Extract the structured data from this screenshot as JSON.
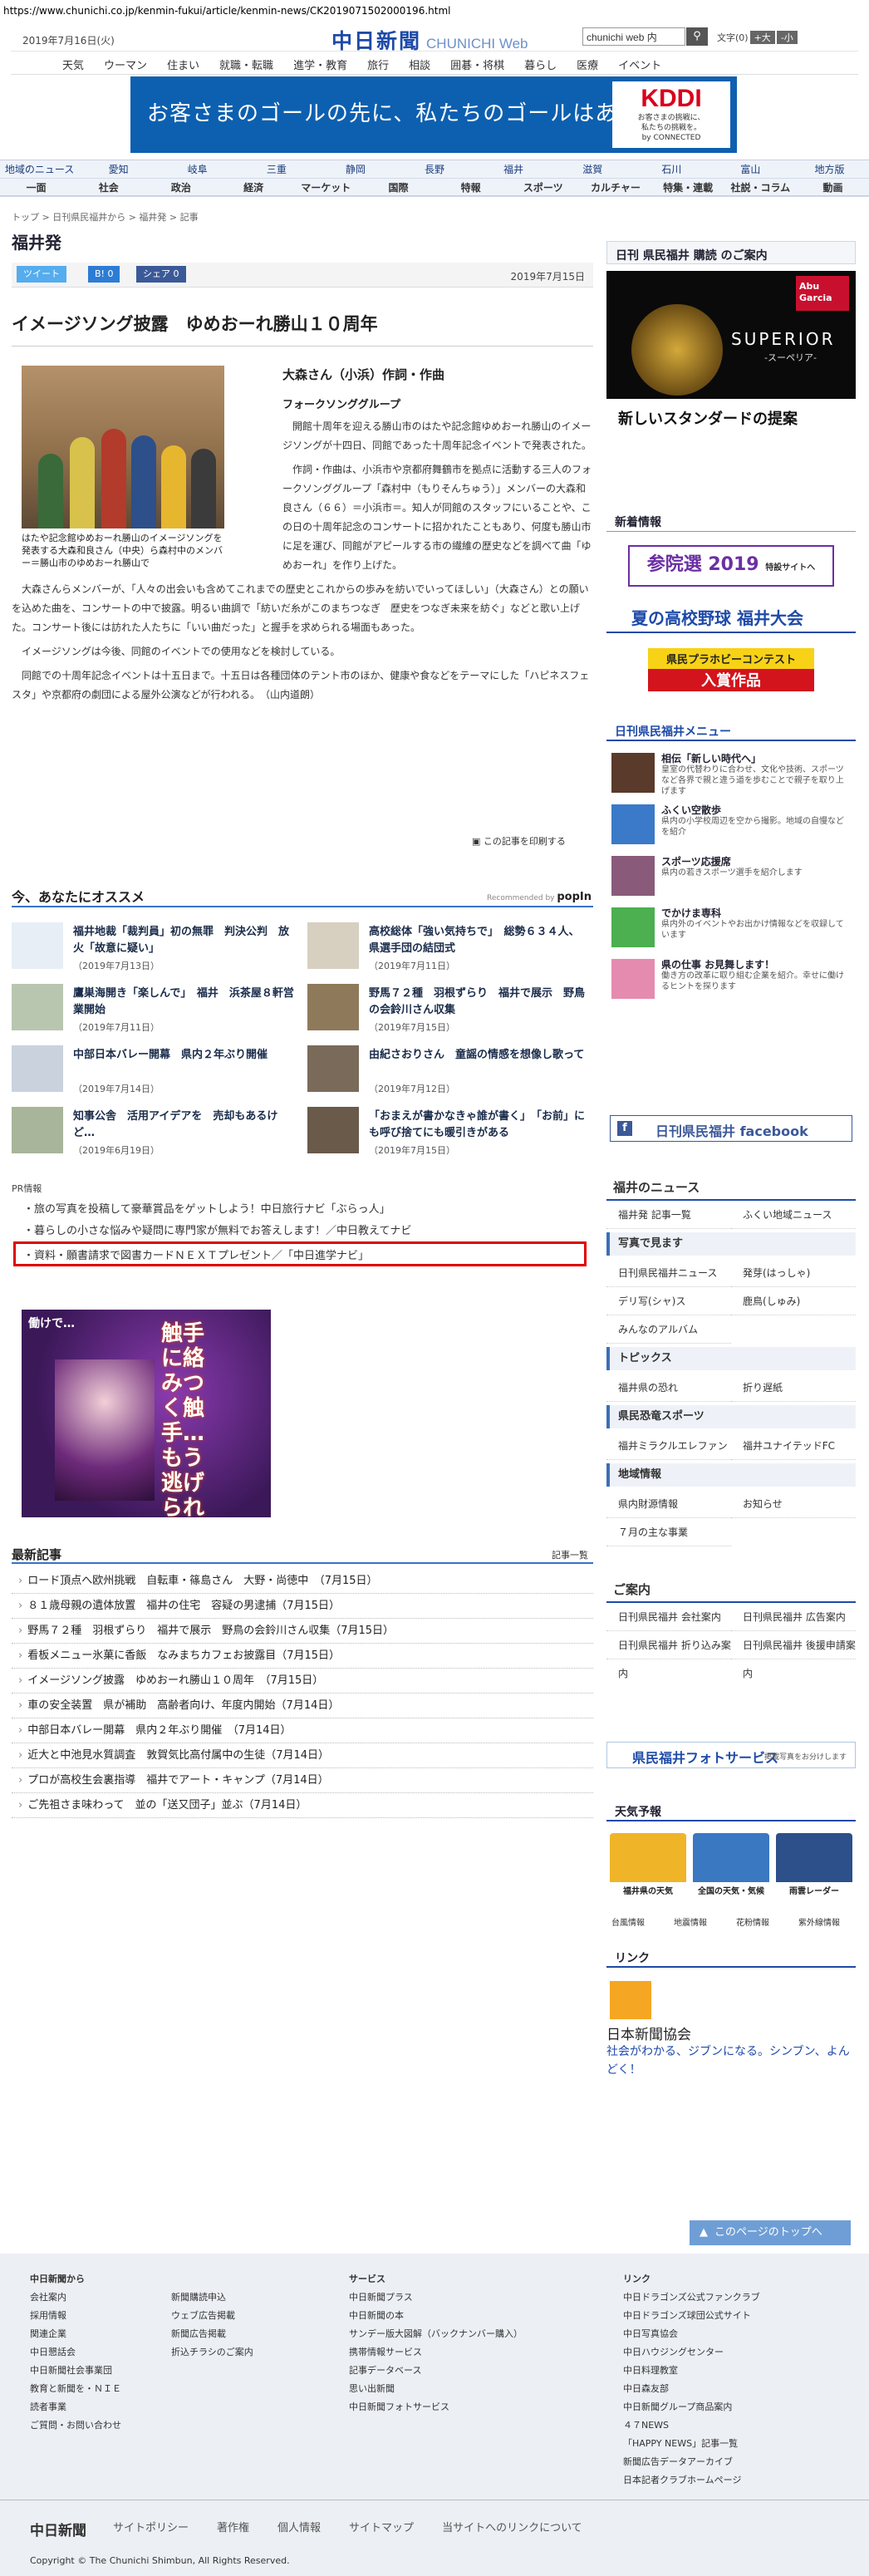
{
  "url": "https://www.chunichi.co.jp/kenmin-fukui/article/kenmin-news/CK2019071502000196.html",
  "header": {
    "date": "2019年7月16日(火)",
    "logo": "中日新聞",
    "logo_sub": "CHUNICHI Web",
    "search_placeholder": "chunichi web 内",
    "search_value": "chunichi web 内",
    "font_label": "文字",
    "font_reset": "(0)",
    "font_plus": "+大",
    "font_minus": "-小"
  },
  "topnav": [
    "天気",
    "ウーマン",
    "住まい",
    "就職・転職",
    "進学・教育",
    "旅行",
    "相談",
    "囲碁・将棋",
    "暮らし",
    "医療",
    "イベント"
  ],
  "ad_top": {
    "text": "お客さまのゴールの先に、私たちのゴールはある。",
    "brand": "KDDI",
    "brand_sub1": "お客さまの挑戦に、",
    "brand_sub2": "私たちの挑戦を。",
    "brand_sub3": "by CONNECTED"
  },
  "catnav": {
    "row1": [
      "地域のニュース",
      "愛知",
      "岐阜",
      "三重",
      "静岡",
      "長野",
      "福井",
      "滋賀",
      "石川",
      "富山",
      "地方版"
    ],
    "row2": [
      "一面",
      "社会",
      "政治",
      "経済",
      "マーケット",
      "国際",
      "特報",
      "スポーツ",
      "カルチャー",
      "特集・連載",
      "社説・コラム",
      "動画"
    ]
  },
  "breadcrumb": "トップ > 日刊県民福井から > 福井発 > 記事",
  "section": "福井発",
  "share": {
    "tweet": "ツイート",
    "b": "B! 0",
    "fb": "シェア 0",
    "date": "2019年7月15日"
  },
  "article": {
    "title": "イメージソング披露　ゆめおーれ勝山１０周年",
    "caption": "はたや記念館ゆめおーれ勝山のイメージソングを発表する大森和良さん（中央）ら森村中のメンバー＝勝山市のゆめおーれ勝山で",
    "sub1": "大森さん（小浜）作詞・作曲",
    "sub2": "フォークソンググループ",
    "p1a": "　開館十周年を迎える勝山市のはたや記念館ゆめおーれ勝山のイメージソングが十四日、同館であった十周年記念イベントで発表された。",
    "p2a": "　作詞・作曲は、小浜市や京都府舞鶴市を拠点に活動する三人のフォークソンググループ「森村中（もりそんちゅう）」メンバーの大森和良さん（６６）＝小浜市＝。知人が同館のスタッフにいることや、この日の十周年記念のコンサートに招かれたこともあり、何度も勝山市に足を運び、同館がアピールする市の繊維の歴史などを調べて曲「ゆめおーれ」を作り上げた。",
    "p3": "　大森さんらメンバーが、「人々の出会いも含めてこれまでの歴史とこれからの歩みを紡いでいってほしい」（大森さん）との願いを込めた曲を、コンサートの中で披露。明るい曲調で「紡いだ糸がこのまちつなぎ　歴史をつなぎ未来を紡ぐ」などと歌い上げた。コンサート後には訪れた人たちに「いい曲だった」と握手を求められる場面もあった。",
    "p4": "　イメージソングは今後、同館のイベントでの使用などを検討している。",
    "p5": "　同館での十周年記念イベントは十五日まで。十五日は各種団体のテント市のほか、健康や食などをテーマにした「ハピネスフェスタ」や京都府の劇団による屋外公演などが行われる。　（山内道朗）",
    "print": "この記事を印刷する"
  },
  "recommend": {
    "title": "今、あなたにオススメ",
    "popin_label": "Recommended by",
    "popin": "popIn",
    "items": [
      {
        "title": "福井地裁「裁判員」初の無罪　判決公判　放火「故意に疑い」",
        "date": "（2019年7月13日）"
      },
      {
        "title": "高校総体「強い気持ちで」　総勢６３４人、県選手団の結団式",
        "date": "（2019年7月11日）"
      },
      {
        "title": "鷹巣海開き「楽しんで」　福井　浜茶屋８軒営業開始",
        "date": "（2019年7月11日）"
      },
      {
        "title": "野馬７２種　羽根ずらり　福井で展示　野鳥の会鈴川さん収集",
        "date": "（2019年7月15日）"
      },
      {
        "title": "中部日本バレー開幕　県内２年ぶり開催",
        "date": "（2019年7月14日）"
      },
      {
        "title": "由紀さおりさん　童謡の情感を想像し歌って",
        "date": "（2019年7月12日）"
      },
      {
        "title": "知事公舎　活用アイデアを　売却もあるけど…",
        "date": "（2019年6月19日）"
      },
      {
        "title": "「おまえが書かなきゃ誰が書く」　「お前」にも呼び捨てにも暖引きがある",
        "date": "（2019年7月15日）"
      }
    ]
  },
  "pr": {
    "label": "PR情報",
    "items": [
      "旅の写真を投稿して豪華賞品をゲットしよう！中日旅行ナビ「ぶらっ人」",
      "暮らしの小さな悩みや疑問に専門家が無料でお答えします！／中日教えてナビ",
      "資料・願書請求で図書カードＮＥＸＴプレゼント／「中日進学ナビ」"
    ]
  },
  "ad2": {
    "top": "働けで…",
    "main": "触手に絡みつく触手…もう逃げられない"
  },
  "latest": {
    "title": "最新記事",
    "more": "記事一覧",
    "items": [
      "ロード頂点へ欧州挑戦　自転車・篠島さん　大野・尚徳中　（7月15日）",
      "８１歳母親の遺体放置　福井の住宅　容疑の男逮捕（7月15日）",
      "野馬７２種　羽根ずらり　福井で展示　野鳥の会鈴川さん収集（7月15日）",
      "看板メニュー氷菓に香飯　なみまちカフェお披露目（7月15日）",
      "イメージソング披露　ゆめおーれ勝山１０周年　（7月15日）",
      "車の安全装置　県が補助　高齢者向け、年度内開始（7月14日）",
      "中部日本バレー開幕　県内２年ぶり開催　（7月14日）",
      "近大と中池見水質調査　敦賀気比高付属中の生徒（7月14日）",
      "プロが高校生会裏指導　福井でアート・キャンプ（7月14日）",
      "ご先祖さま味わって　並の「送又団子」並ぶ（7月14日）"
    ]
  },
  "sidebar": {
    "subscribe": "日刊 県民福井 購読 のご案内",
    "ad_brand": "Abu Garcia",
    "ad_product": "SUPERIOR",
    "ad_product_sub": "-スーペリア-",
    "ad_text": "新しいスタンダードの提案",
    "new_info": "新着情報",
    "senkyo": "参院選 2019",
    "senkyo_sub": "特設サイトへ",
    "koshien": "夏の高校野球 福井大会",
    "puramo": "県民プラホビーコンテスト",
    "puramo_sub": "入賞作品",
    "menu_title": "日刊県民福井メニュー",
    "menu": [
      {
        "t": "相伝「新しい時代へ」",
        "d": "皇室の代替わりに合わせ、文化や技術、スポーツなど各界で親と違う道を歩むことで親子を取り上げます"
      },
      {
        "t": "ふくい空散歩",
        "d": "県内の小学校周辺を空から撮影。地域の自慢などを紹介"
      },
      {
        "t": "スポーツ応援席",
        "d": "県内の若きスポーツ選手を紹介します"
      },
      {
        "t": "でかけま専科",
        "d": "県内外のイベントやお出かけ情報などを収録しています"
      },
      {
        "t": "県の仕事 お見舞します！",
        "d": "働き方の改革に取り組む企業を紹介。幸せに働けるヒントを探ります"
      }
    ],
    "facebook": "日刊県民福井 facebook",
    "fukui_news": "福井のニュース",
    "news_links": [
      "福井発 記事一覧",
      "ふくい地域ニュース"
    ],
    "photo_head": "写真で見ます",
    "photo_links": [
      "日刊県民福井ニュース",
      "発芽(はっしゃ)",
      "デリ写(シャ)ス",
      "鹿鳥(しゅみ)",
      "みんなのアルバム"
    ],
    "topics_head": "トピックス",
    "topics_links": [
      "福井県の恐れ",
      "折り遅紙"
    ],
    "sports_head": "県民恐竜スポーツ",
    "sports_links": [
      "福井ミラクルエレファンツ",
      "福井ユナイテッドFC"
    ],
    "area_head": "地域情報",
    "area_links": [
      "県内財源情報",
      "お知らせ",
      "７月の主な事業"
    ],
    "annai": "ご案内",
    "annai_links": [
      "日刊県民福井 会社案内",
      "日刊県民福井 広告案内",
      "日刊県民福井 折り込み案内",
      "日刊県民福井 後援申請案内"
    ],
    "photo_service": "県民福井フォトサービス",
    "photo_service_sub": "掲載写真をお分けします",
    "weather": "天気予報",
    "weather_cards": [
      "福井県の天気",
      "全国の天気・気候",
      "雨雲レーダー"
    ],
    "weather_links": [
      "台風情報",
      "地震情報",
      "花粉情報",
      "紫外線情報"
    ],
    "link": "リンク",
    "link_name": "日本新聞協会",
    "link_slogan": "社会がわかる、ジブンになる。シンブン、よんどく！"
  },
  "footer": {
    "toplink": "このページのトップへ",
    "col1_head": "中日新聞から",
    "col1": [
      "会社案内",
      "採用情報",
      "関連企業",
      "中日懇話会",
      "中日新聞社会事業団",
      "教育と新聞を・ＮＩＥ",
      "読者事業",
      "ご質問・お問い合わせ"
    ],
    "col2": [
      "新聞購読申込",
      "ウェブ広告掲載",
      "新聞広告掲載",
      "折込チラシのご案内"
    ],
    "col3_head": "サービス",
    "col3": [
      "中日新聞プラス",
      "中日新聞の本",
      "サンデー版大図解（バックナンバー購入）",
      "携帯情報サービス",
      "記事データベース",
      "思い出新聞",
      "中日新聞フォトサービス"
    ],
    "col4_head": "リンク",
    "col4": [
      "中日ドラゴンズ公式ファンクラブ",
      "中日ドラゴンズ球団公式サイト",
      "中日写真協会",
      "中日ハウジングセンター",
      "中日料理教室",
      "中日森友部",
      "中日新聞グループ商品案内",
      "４７NEWS",
      "「HAPPY NEWS」記事一覧",
      "新聞広告データアーカイブ",
      "日本記者クラブホームページ"
    ],
    "bottom_logo": "中日新聞",
    "bottom_links": [
      "サイトポリシー",
      "著作権",
      "個人情報",
      "サイトマップ",
      "当サイトへのリンクについて"
    ],
    "copyright": "Copyright © The Chunichi Shimbun, All Rights Reserved."
  }
}
